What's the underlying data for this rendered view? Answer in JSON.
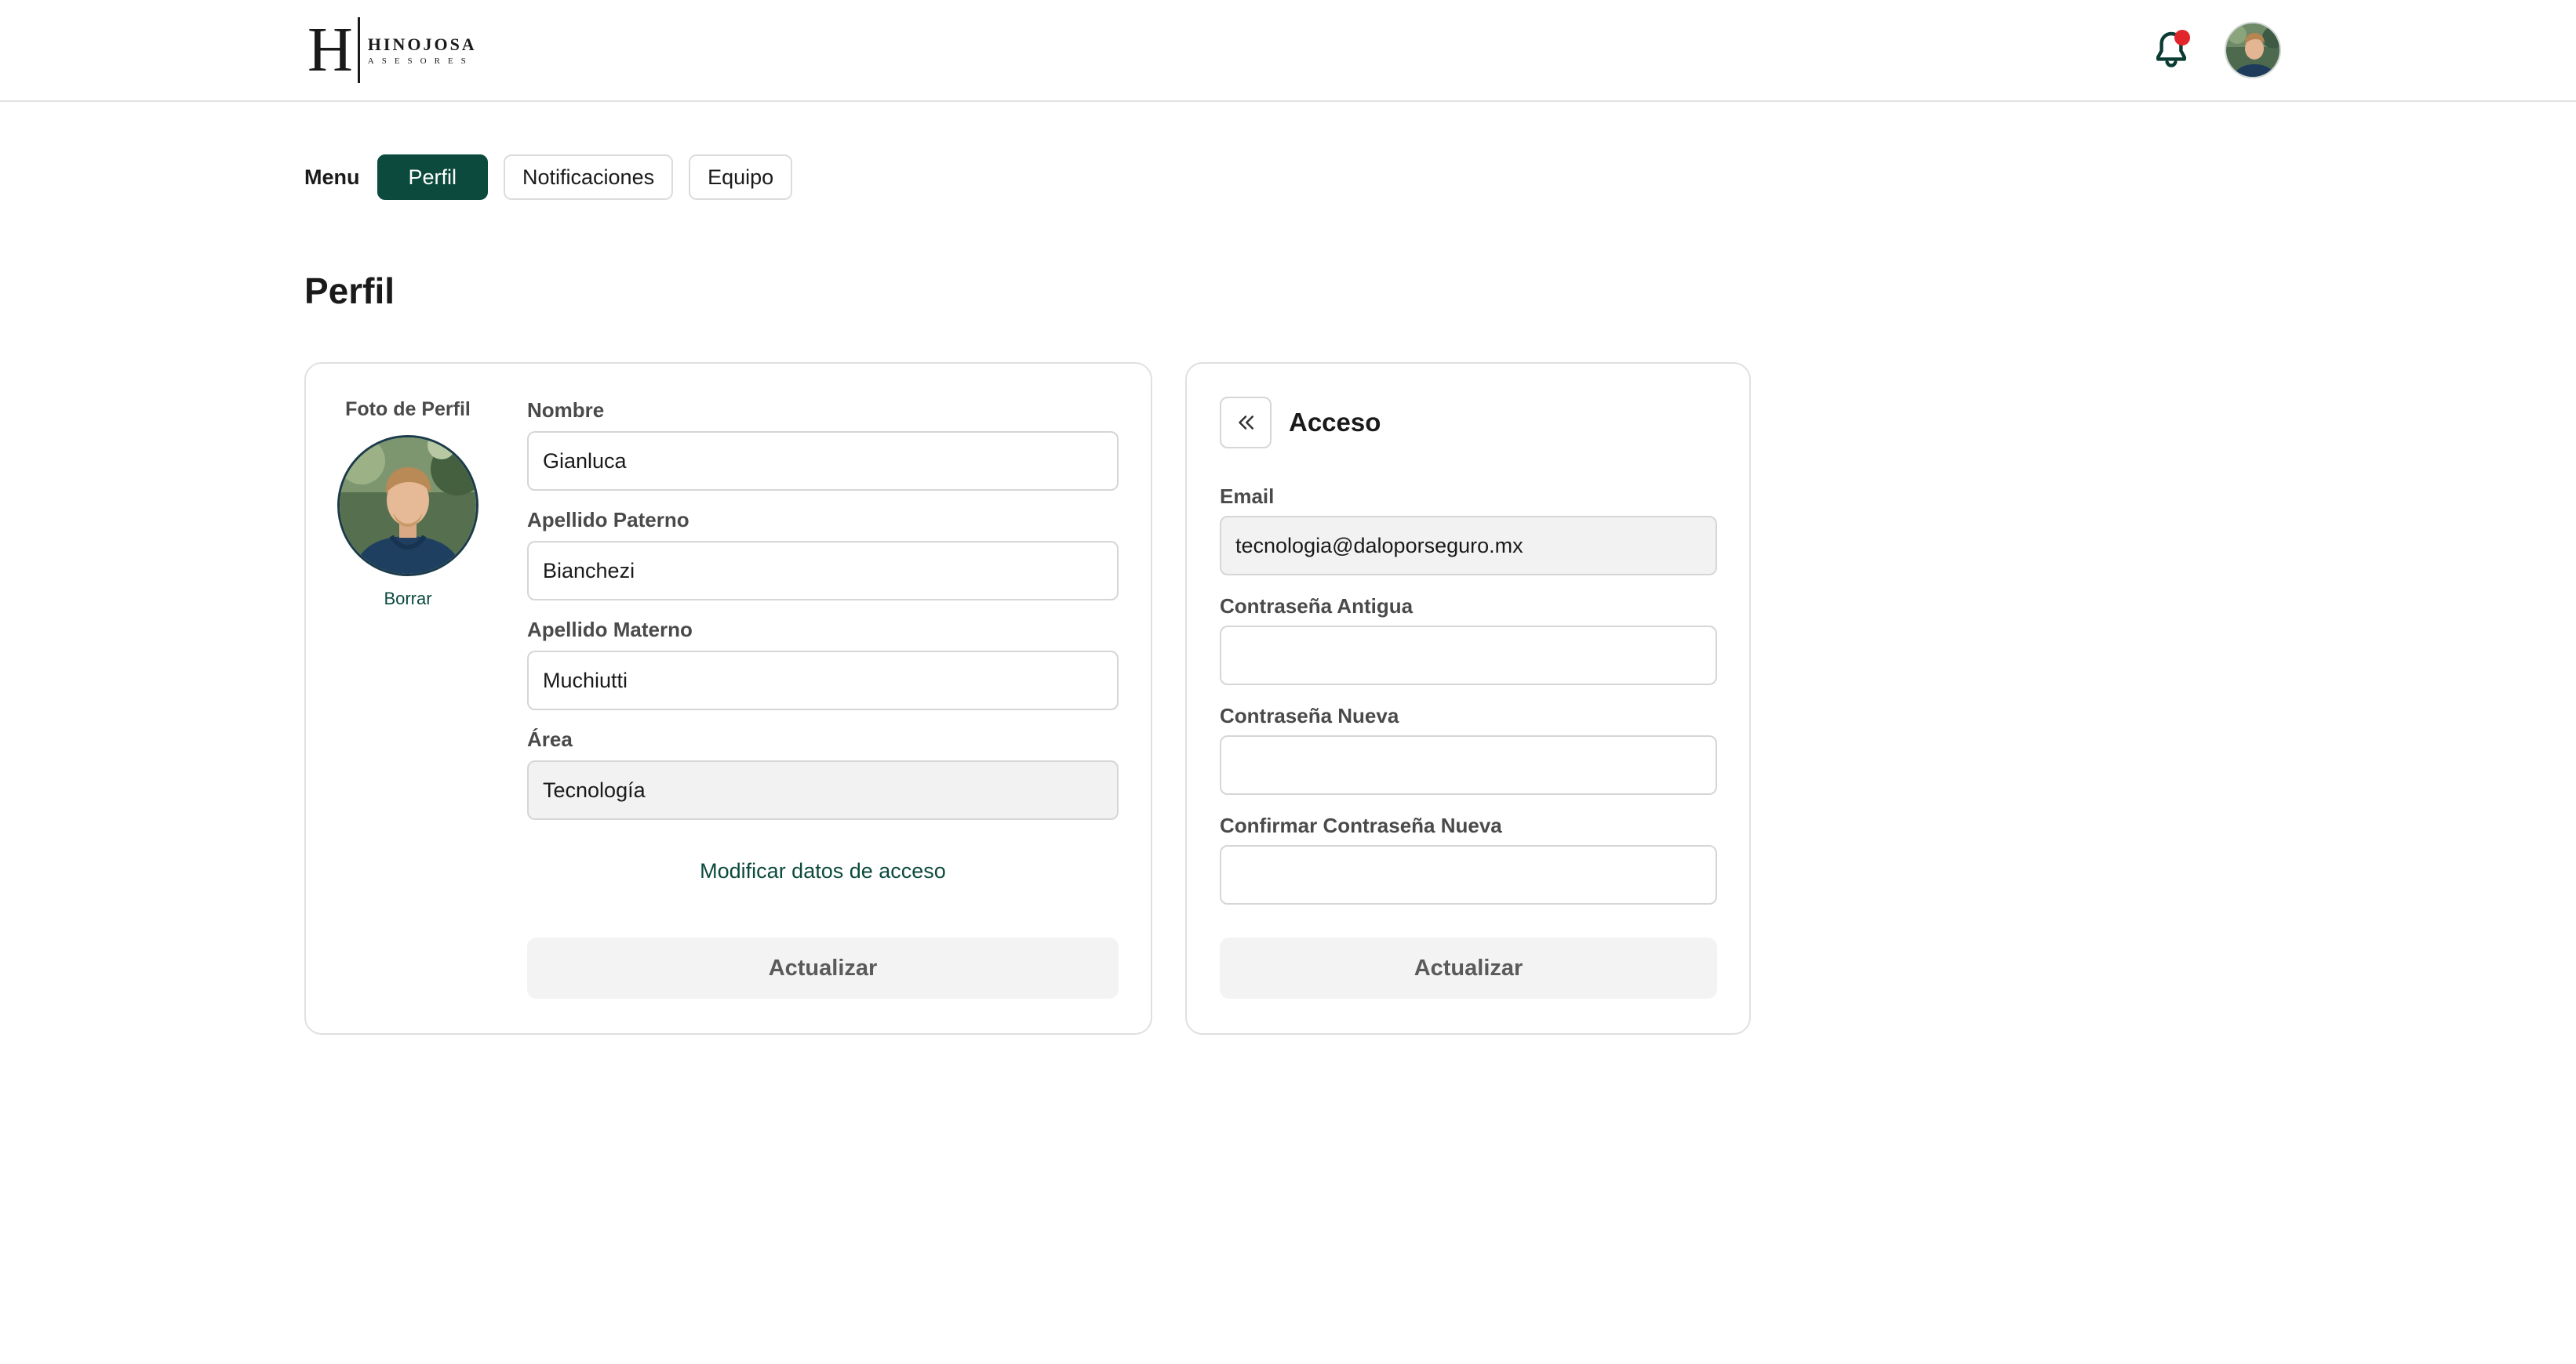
{
  "brand": {
    "logo_letter": "H",
    "logo_name": "HINOJOSA",
    "logo_sub": "ASESORES"
  },
  "header": {
    "notification_icon": "bell-icon",
    "notification_badge_color": "#e0262b"
  },
  "menu": {
    "label": "Menu",
    "tabs": [
      {
        "label": "Perfil",
        "active": true
      },
      {
        "label": "Notificaciones",
        "active": false
      },
      {
        "label": "Equipo",
        "active": false
      }
    ]
  },
  "page": {
    "title": "Perfil"
  },
  "profile": {
    "photo_label": "Foto de Perfil",
    "delete_label": "Borrar",
    "fields": {
      "nombre": {
        "label": "Nombre",
        "value": "Gianluca"
      },
      "apellido_paterno": {
        "label": "Apellido Paterno",
        "value": "Bianchezi"
      },
      "apellido_materno": {
        "label": "Apellido Materno",
        "value": "Muchiutti"
      },
      "area": {
        "label": "Área",
        "value": "Tecnología"
      }
    },
    "modify_access_link": "Modificar datos de acceso",
    "update_button": "Actualizar"
  },
  "access": {
    "title": "Acceso",
    "back_icon": "double-chevron-left-icon",
    "fields": {
      "email": {
        "label": "Email",
        "value": "tecnologia@daloporseguro.mx"
      },
      "old_password": {
        "label": "Contraseña Antigua",
        "value": ""
      },
      "new_password": {
        "label": "Contraseña Nueva",
        "value": ""
      },
      "confirm_password": {
        "label": "Confirmar Contraseña Nueva",
        "value": ""
      }
    },
    "update_button": "Actualizar"
  },
  "colors": {
    "brand_green": "#0b4a3c",
    "disabled_bg": "#f2f2f2"
  }
}
